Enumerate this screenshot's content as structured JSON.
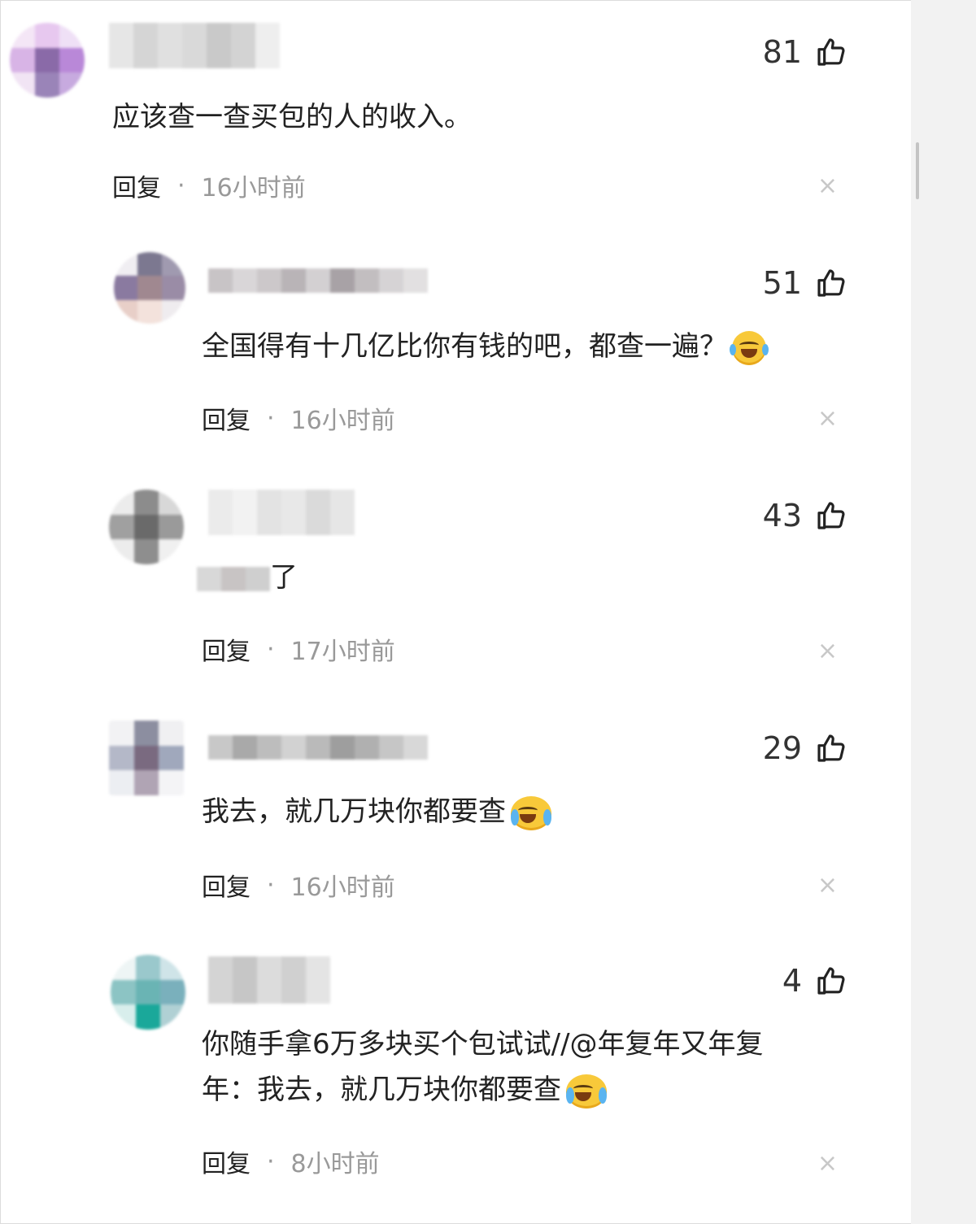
{
  "comments": [
    {
      "likes": "81",
      "text": "应该查一查买包的人的收入。",
      "reply_label": "回复",
      "dot": "·",
      "time": "16小时前",
      "close": "×"
    },
    {
      "likes": "51",
      "text": "全国得有十几亿比你有钱的吧，都查一遍？",
      "emoji": "laughing-tears-emoji",
      "reply_label": "回复",
      "dot": "·",
      "time": "16小时前",
      "close": "×"
    },
    {
      "likes": "43",
      "text": "了",
      "reply_label": "回复",
      "dot": "·",
      "time": "17小时前",
      "close": "×"
    },
    {
      "likes": "29",
      "text": "我去，就几万块你都要查",
      "emoji": "crying-emoji",
      "reply_label": "回复",
      "dot": "·",
      "time": "16小时前",
      "close": "×"
    },
    {
      "likes": "4",
      "text_line1": "你随手拿6万多块买个包试试//@年复年又年复",
      "text_line2": "年：我去，就几万块你都要查",
      "emoji": "crying-emoji",
      "reply_label": "回复",
      "dot": "·",
      "time": "8小时前",
      "close": "×"
    }
  ],
  "icons": {
    "like": "thumbs-up-icon",
    "close": "close-icon"
  },
  "colors": {
    "text": "#222222",
    "muted": "#999999",
    "close": "#c8c8c8",
    "panel": "#f2f2f2"
  }
}
